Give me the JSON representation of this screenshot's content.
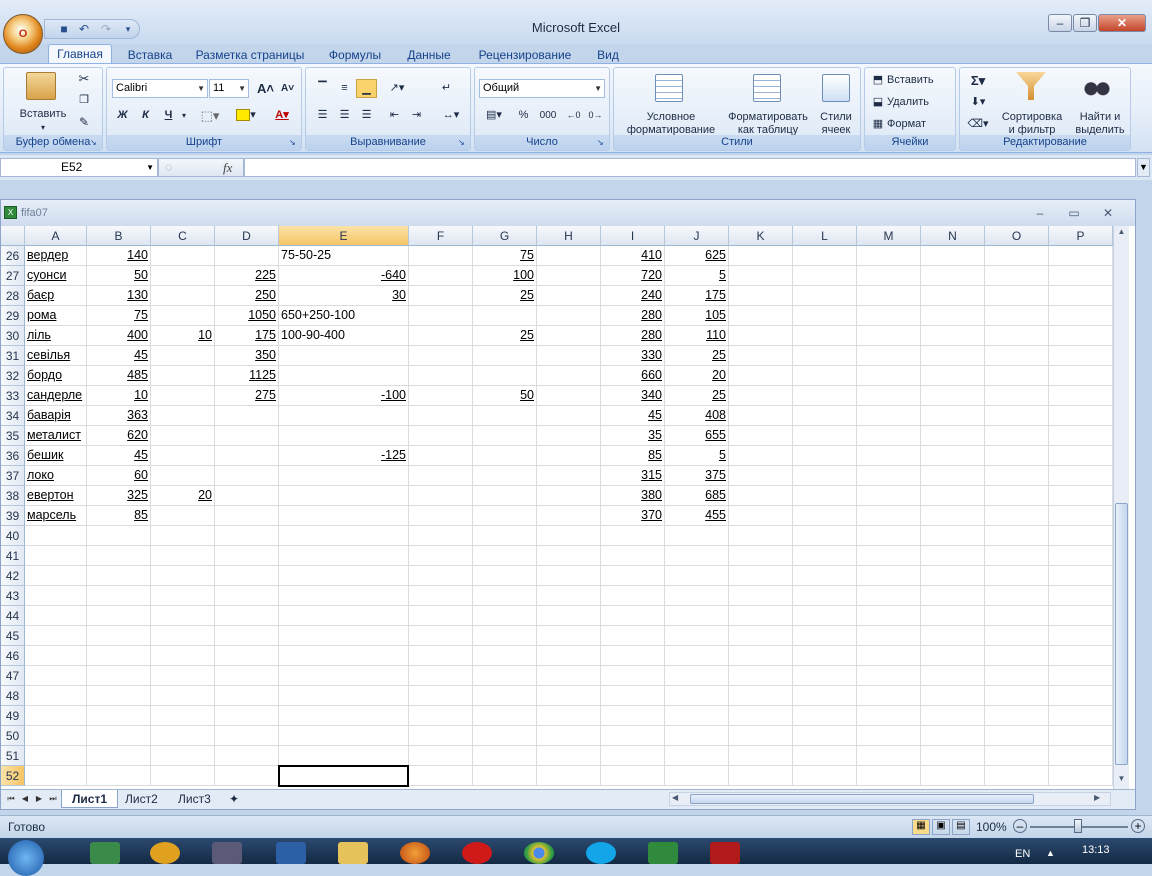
{
  "app": {
    "title": "Microsoft Excel",
    "office_button_label": "O"
  },
  "tabs": [
    "Главная",
    "Вставка",
    "Разметка страницы",
    "Формулы",
    "Данные",
    "Рецензирование",
    "Вид"
  ],
  "ribbon": {
    "clipboard": {
      "label": "Буфер обмена",
      "paste": "Вставить"
    },
    "font": {
      "label": "Шрифт",
      "font_name": "Calibri",
      "font_size": "11",
      "bold": "Ж",
      "italic": "К",
      "underline": "Ч"
    },
    "alignment": {
      "label": "Выравнивание"
    },
    "number": {
      "label": "Число",
      "format": "Общий",
      "percent": "%",
      "thousands": "000"
    },
    "styles": {
      "label": "Стили",
      "conditional_line1": "Условное",
      "conditional_line2": "форматирование",
      "format_table_line1": "Форматировать",
      "format_table_line2": "как таблицу",
      "cell_styles_line1": "Стили",
      "cell_styles_line2": "ячеек"
    },
    "cells": {
      "label": "Ячейки",
      "insert": "Вставить",
      "delete": "Удалить",
      "format": "Формат"
    },
    "editing": {
      "label": "Редактирование",
      "sort_line1": "Сортировка",
      "sort_line2": "и фильтр",
      "find_line1": "Найти и",
      "find_line2": "выделить"
    }
  },
  "formula_bar": {
    "name_box": "E52",
    "fx": "fx",
    "formula": ""
  },
  "workbook": {
    "title": "fifa07"
  },
  "columns": [
    "A",
    "B",
    "C",
    "D",
    "E",
    "F",
    "G",
    "H",
    "I",
    "J",
    "K",
    "L",
    "M",
    "N",
    "O",
    "P"
  ],
  "rows": [
    {
      "n": "26",
      "A": "вердер",
      "B": "140",
      "C": "",
      "D": "",
      "E": "75-50-25",
      "F": "",
      "G": "75",
      "H": "",
      "I": "410",
      "J": "625"
    },
    {
      "n": "27",
      "A": "суонси",
      "B": "50",
      "C": "",
      "D": "225",
      "E": "-640",
      "F": "",
      "G": "100",
      "H": "",
      "I": "720",
      "J": "5"
    },
    {
      "n": "28",
      "A": "баєр",
      "B": "130",
      "C": "",
      "D": "250",
      "E": "30",
      "F": "",
      "G": "25",
      "H": "",
      "I": "240",
      "J": "175"
    },
    {
      "n": "29",
      "A": "рома",
      "B": "75",
      "C": "",
      "D": "1050",
      "E": "650+250-100",
      "F": "",
      "G": "",
      "H": "",
      "I": "280",
      "J": "105"
    },
    {
      "n": "30",
      "A": "ліль",
      "B": "400",
      "C": "10",
      "D": "175",
      "E": "100-90-400",
      "F": "",
      "G": "25",
      "H": "",
      "I": "280",
      "J": "110"
    },
    {
      "n": "31",
      "A": "севілья",
      "B": "45",
      "C": "",
      "D": "350",
      "E": "",
      "F": "",
      "G": "",
      "H": "",
      "I": "330",
      "J": "25"
    },
    {
      "n": "32",
      "A": "бордо",
      "B": "485",
      "C": "",
      "D": "1125",
      "E": "",
      "F": "",
      "G": "",
      "H": "",
      "I": "660",
      "J": "20"
    },
    {
      "n": "33",
      "A": "сандерле",
      "B": "10",
      "C": "",
      "D": "275",
      "E": "-100",
      "F": "",
      "G": "50",
      "H": "",
      "I": "340",
      "J": "25"
    },
    {
      "n": "34",
      "A": "баварія",
      "B": "363",
      "C": "",
      "D": "",
      "E": "",
      "F": "",
      "G": "",
      "H": "",
      "I": "45",
      "J": "408"
    },
    {
      "n": "35",
      "A": "металист",
      "B": "620",
      "C": "",
      "D": "",
      "E": "",
      "F": "",
      "G": "",
      "H": "",
      "I": "35",
      "J": "655"
    },
    {
      "n": "36",
      "A": "бешик",
      "B": "45",
      "C": "",
      "D": "",
      "E": "-125",
      "F": "",
      "G": "",
      "H": "",
      "I": "85",
      "J": "5"
    },
    {
      "n": "37",
      "A": "локо",
      "B": "60",
      "C": "",
      "D": "",
      "E": "",
      "F": "",
      "G": "",
      "H": "",
      "I": "315",
      "J": "375"
    },
    {
      "n": "38",
      "A": "евертон",
      "B": "325",
      "C": "20",
      "D": "",
      "E": "",
      "F": "",
      "G": "",
      "H": "",
      "I": "380",
      "J": "685"
    },
    {
      "n": "39",
      "A": "марсель",
      "B": "85",
      "C": "",
      "D": "",
      "E": "",
      "F": "",
      "G": "",
      "H": "",
      "I": "370",
      "J": "455"
    },
    {
      "n": "40"
    },
    {
      "n": "41"
    },
    {
      "n": "42"
    },
    {
      "n": "43"
    },
    {
      "n": "44"
    },
    {
      "n": "45"
    },
    {
      "n": "46"
    },
    {
      "n": "47"
    },
    {
      "n": "48"
    },
    {
      "n": "49"
    },
    {
      "n": "50"
    },
    {
      "n": "51"
    },
    {
      "n": "52"
    }
  ],
  "text_cells_E": [
    "75-50-25",
    "650+250-100",
    "100-90-400"
  ],
  "sheets": [
    "Лист1",
    "Лист2",
    "Лист3"
  ],
  "active_sheet": "Лист1",
  "status": {
    "ready": "Готово",
    "zoom": "100%"
  },
  "taskbar": {
    "lang": "EN",
    "time": "13:13"
  },
  "colors": {
    "accent": "#15428b",
    "selected_header": "#f5c465",
    "ribbon_bg": "#dce8f6"
  }
}
